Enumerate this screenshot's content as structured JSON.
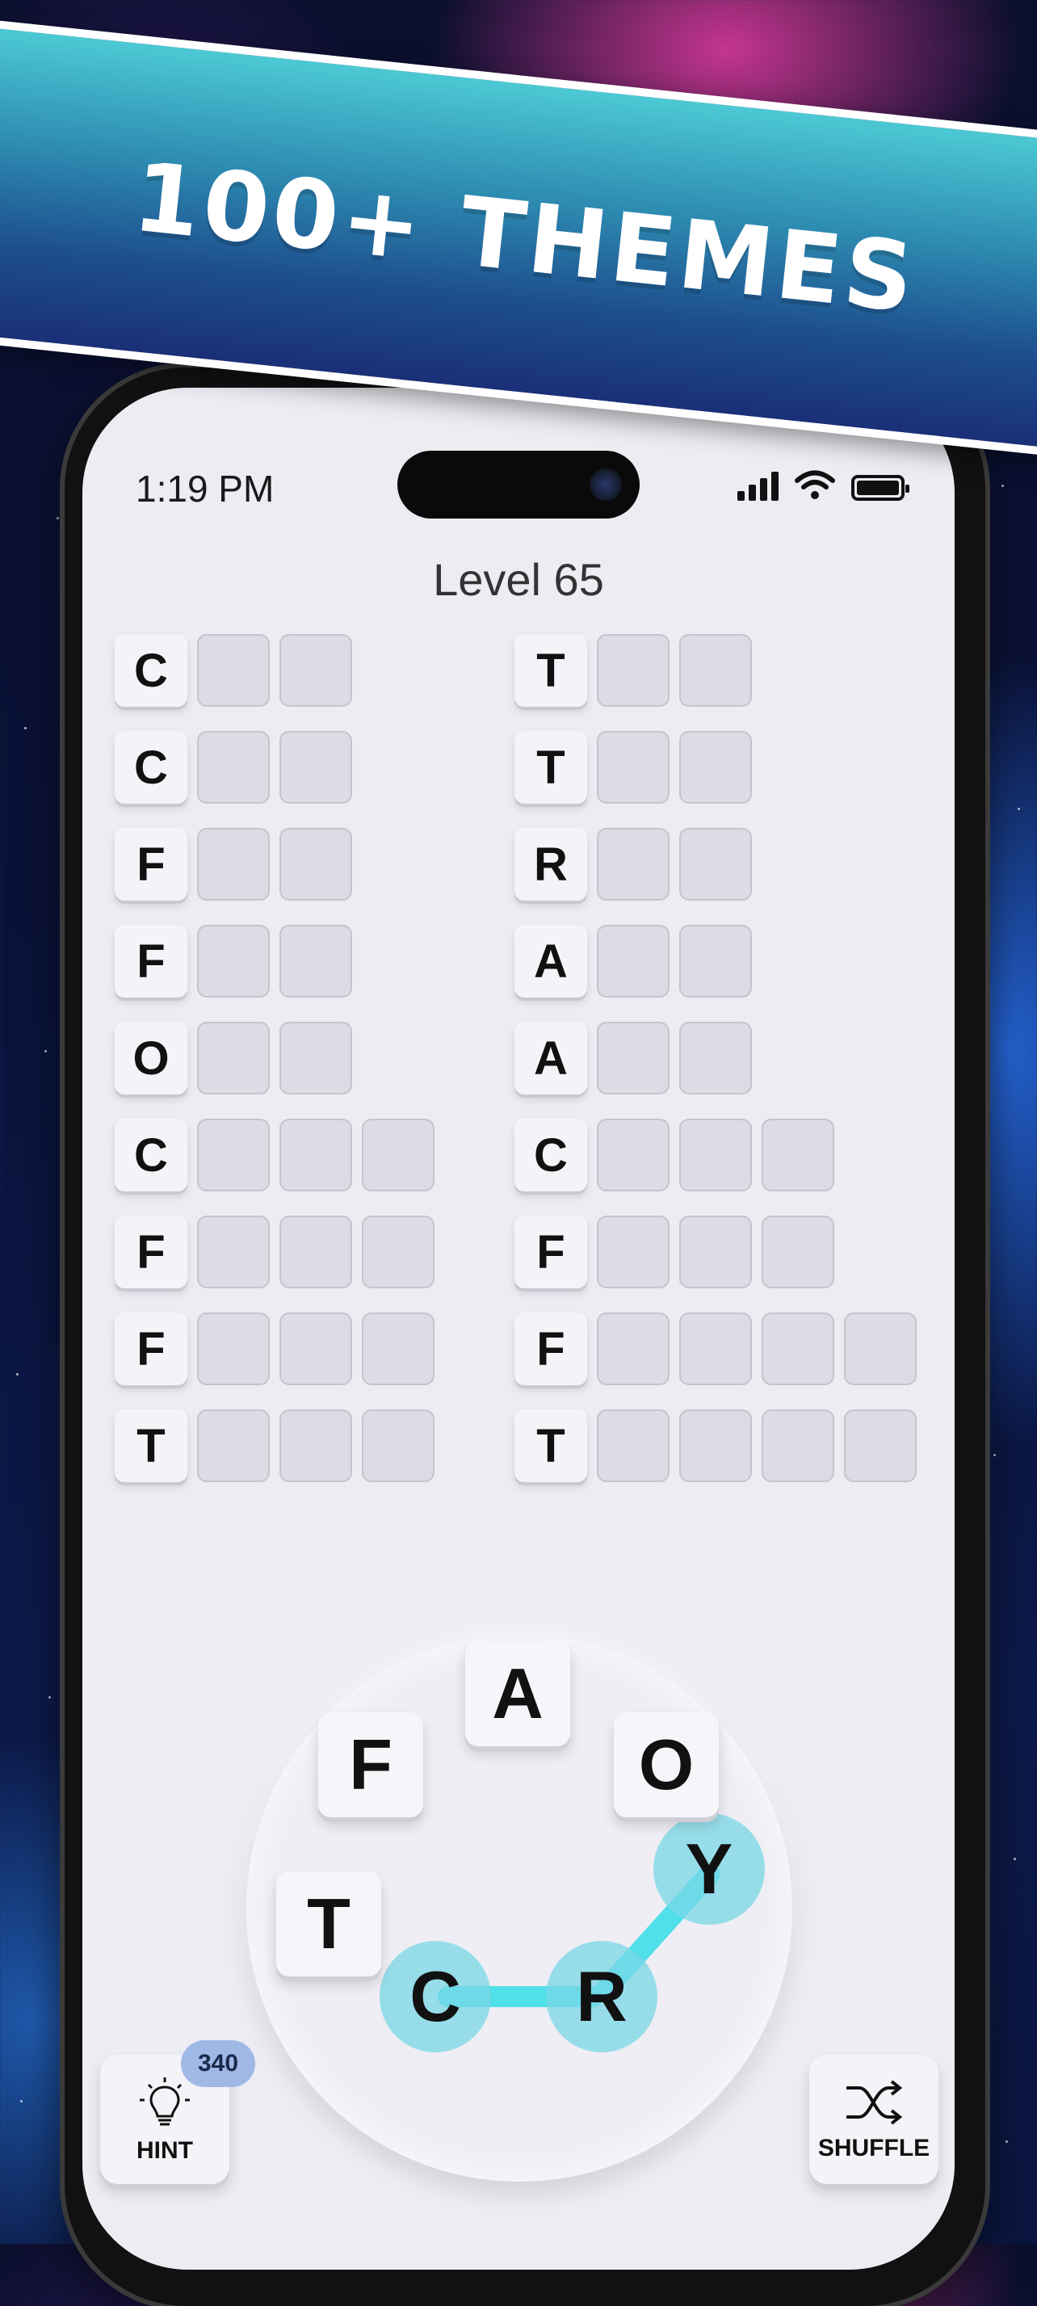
{
  "banner": {
    "title": "100+ THEMES"
  },
  "status_bar": {
    "time": "1:19 PM"
  },
  "game": {
    "level": "Level 65",
    "left_words": [
      {
        "first": "C",
        "len": 3
      },
      {
        "first": "C",
        "len": 3
      },
      {
        "first": "F",
        "len": 3
      },
      {
        "first": "F",
        "len": 3
      },
      {
        "first": "O",
        "len": 3
      },
      {
        "first": "C",
        "len": 4
      },
      {
        "first": "F",
        "len": 4
      },
      {
        "first": "F",
        "len": 4
      },
      {
        "first": "T",
        "len": 4
      }
    ],
    "right_words": [
      {
        "first": "T",
        "len": 3
      },
      {
        "first": "T",
        "len": 3
      },
      {
        "first": "R",
        "len": 3
      },
      {
        "first": "A",
        "len": 3
      },
      {
        "first": "A",
        "len": 3
      },
      {
        "first": "C",
        "len": 4
      },
      {
        "first": "F",
        "len": 4
      },
      {
        "first": "F",
        "len": 5
      },
      {
        "first": "T",
        "len": 5
      }
    ],
    "wheel_letters": {
      "a": "A",
      "f": "F",
      "o": "O",
      "t": "T",
      "y": "Y",
      "c": "C",
      "r": "R"
    },
    "selected_path": [
      "C",
      "R",
      "Y"
    ],
    "selection_color": "#4fe0ea"
  },
  "controls": {
    "hint_label": "HINT",
    "hint_count": "340",
    "shuffle_label": "SHUFFLE"
  },
  "icons": {
    "hint": "lightbulb-icon",
    "shuffle": "shuffle-icon"
  }
}
